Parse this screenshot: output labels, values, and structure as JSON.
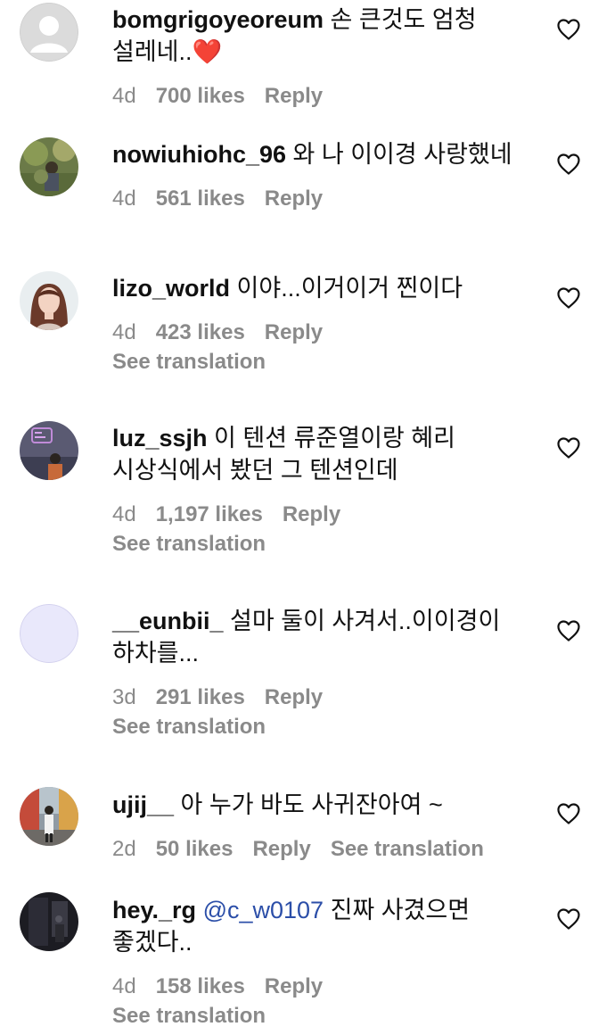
{
  "comments": [
    {
      "username": "bomgrigoyeoreum",
      "text": " 손 큰것도 엄청 설레네..❤️",
      "time": "4d",
      "likes": "700 likes",
      "reply": "Reply",
      "avatar": "default-avatar"
    },
    {
      "username": "nowiuhiohc_96",
      "text": " 와 나 이이경 사랑했네",
      "time": "4d",
      "likes": "561 likes",
      "reply": "Reply",
      "avatar": "outdoor-photo-avatar"
    },
    {
      "username": "lizo_world",
      "text": " 이야...이거이거 찐이다",
      "time": "4d",
      "likes": "423 likes",
      "reply": "Reply",
      "see_translation": "See translation",
      "avatar": "portrait-avatar"
    },
    {
      "username": "luz_ssjh",
      "text": " 이 텐션 류준열이랑 혜리 시상식에서 봤던 그 텐션인데",
      "time": "4d",
      "likes": "1,197 likes",
      "reply": "Reply",
      "see_translation": "See translation",
      "avatar": "neon-sign-avatar"
    },
    {
      "username": "__eunbii_",
      "text": " 설마 둘이 사겨서..이이경이 하차를...",
      "time": "3d",
      "likes": "291 likes",
      "reply": "Reply",
      "see_translation": "See translation",
      "avatar": "lavender-avatar"
    },
    {
      "username": "ujij__",
      "text": " 아 누가 바도 사귀잔아여 ~",
      "time": "2d",
      "likes": "50 likes",
      "reply": "Reply",
      "see_translation": "See translation",
      "avatar": "street-photo-avatar"
    },
    {
      "username": "hey._rg",
      "mention": "@c_w0107",
      "text": " 진짜 사겼으면 좋겠다..",
      "time": "4d",
      "likes": "158 likes",
      "reply": "Reply",
      "see_translation": "See translation",
      "avatar": "dark-photo-avatar"
    }
  ],
  "colors": {
    "text": "#111111",
    "meta": "#8a8a8a",
    "mention": "#2b4ea8"
  },
  "icons": {
    "like": "heart-outline-icon"
  }
}
